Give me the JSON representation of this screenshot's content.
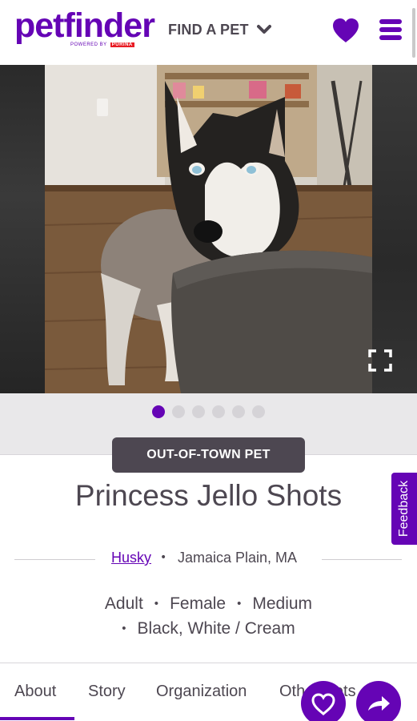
{
  "header": {
    "logo_text": "petfinder",
    "logo_powered": "POWERED BY",
    "logo_brand": "PURINA",
    "find_a_pet_label": "FIND A PET"
  },
  "colors": {
    "brand_purple": "#6504b5",
    "dark_gray": "#4d4751"
  },
  "icons": {
    "find_pet_caret": "chevron-down-icon",
    "favorites": "heart-icon",
    "menu": "hamburger-menu-icon",
    "fullscreen": "expand-icon",
    "fab_favorite": "heart-outline-icon",
    "fab_share": "share-arrow-icon"
  },
  "carousel": {
    "total_photos": 6,
    "active_index": 0
  },
  "badge": {
    "label": "OUT-OF-TOWN PET"
  },
  "pet": {
    "name": "Princess Jello Shots",
    "breed": "Husky",
    "location": "Jamaica Plain, MA",
    "age": "Adult",
    "gender": "Female",
    "size": "Medium",
    "color": "Black, White / Cream"
  },
  "tabs": [
    {
      "label": "About"
    },
    {
      "label": "Story"
    },
    {
      "label": "Organization"
    },
    {
      "label": "Other Pets"
    }
  ],
  "feedback_label": "Feedback"
}
